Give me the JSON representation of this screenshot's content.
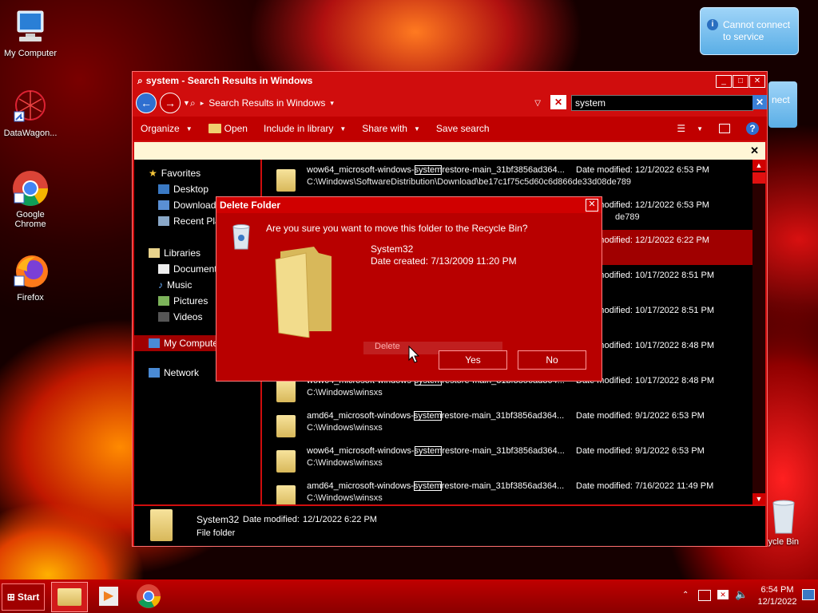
{
  "desktop": {
    "icons": [
      {
        "label": "My Computer",
        "icon": "computer-icon"
      },
      {
        "label": "DataWagon...",
        "icon": "datawagon-icon"
      },
      {
        "label": "Google Chrome",
        "icon": "chrome-icon"
      },
      {
        "label": "Firefox",
        "icon": "firefox-icon"
      },
      {
        "label": "Recycle Bin",
        "icon": "recycle-bin-icon"
      }
    ],
    "recycle_partial": "cycle Bin"
  },
  "notification": {
    "text": "Cannot connect to service",
    "line1": "Cannot connect",
    "line2": "to service",
    "partial_behind": "nect"
  },
  "explorer": {
    "title": "system - Search Results in Windows",
    "address": "Search Results in Windows",
    "search_value": "system",
    "toolbar": {
      "organize": "Organize",
      "open": "Open",
      "include": "Include in library",
      "share": "Share with",
      "save_search": "Save search"
    },
    "nav": {
      "favorites": "Favorites",
      "desktop": "Desktop",
      "downloads": "Downloads",
      "recent": "Recent Pla",
      "libraries": "Libraries",
      "documents": "Documents",
      "music": "Music",
      "pictures": "Pictures",
      "videos": "Videos",
      "my_computer": "My Computer",
      "network": "Network"
    },
    "rows": [
      {
        "pre": "wow64_microsoft-windows-",
        "hit": "system",
        "post": "restore-main_31bf3856ad364...",
        "path": "C:\\Windows\\SoftwareDistribution\\Download\\be17c1f75c5d60c6d866de33d08de789",
        "date": "Date modified: 12/1/2022 6:53 PM"
      },
      {
        "pre": "",
        "hit": "",
        "post": "",
        "path": "de789",
        "date": "Date modified: 12/1/2022 6:53 PM"
      },
      {
        "pre": "",
        "hit": "",
        "post": "",
        "path": "",
        "date": "Date modified: 12/1/2022 6:22 PM"
      },
      {
        "pre": "",
        "hit": "",
        "post": "",
        "path": "",
        "date": "Date modified: 10/17/2022 8:51 PM"
      },
      {
        "pre": "",
        "hit": "",
        "post": "",
        "path": "",
        "date": "Date modified: 10/17/2022 8:51 PM"
      },
      {
        "pre": "",
        "hit": "",
        "post": "",
        "path": "",
        "date": "Date modified: 10/17/2022 8:48 PM"
      },
      {
        "pre": "wow64_microsoft-windows-",
        "hit": "system",
        "post": "restore-main_31bf3856ad364...",
        "path": "C:\\Windows\\winsxs",
        "date": "Date modified: 10/17/2022 8:48 PM"
      },
      {
        "pre": "amd64_microsoft-windows-",
        "hit": "system",
        "post": "restore-main_31bf3856ad364...",
        "path": "C:\\Windows\\winsxs",
        "date": "Date modified: 9/1/2022 6:53 PM"
      },
      {
        "pre": "wow64_microsoft-windows-",
        "hit": "system",
        "post": "restore-main_31bf3856ad364...",
        "path": "C:\\Windows\\winsxs",
        "date": "Date modified: 9/1/2022 6:53 PM"
      },
      {
        "pre": "amd64_microsoft-windows-",
        "hit": "system",
        "post": "restore-main_31bf3856ad364...",
        "path": "C:\\Windows\\winsxs",
        "date": "Date modified: 7/16/2022 11:49 PM"
      }
    ],
    "details": {
      "name": "System32",
      "date_label": "Date modified:",
      "date_value": "12/1/2022 6:22 PM",
      "type": "File folder"
    }
  },
  "dialog": {
    "title": "Delete Folder",
    "question": "Are you sure you want to move this folder to the Recycle Bin?",
    "folder_name": "System32",
    "created": "Date created: 7/13/2009 11:20 PM",
    "ghost": "Delete",
    "yes": "Yes",
    "no": "No"
  },
  "taskbar": {
    "start": "Start",
    "time": "6:54 PM",
    "date": "12/1/2022"
  },
  "colors": {
    "window": "#d00d0d",
    "content": "#000000",
    "accent": "#ff8080"
  }
}
